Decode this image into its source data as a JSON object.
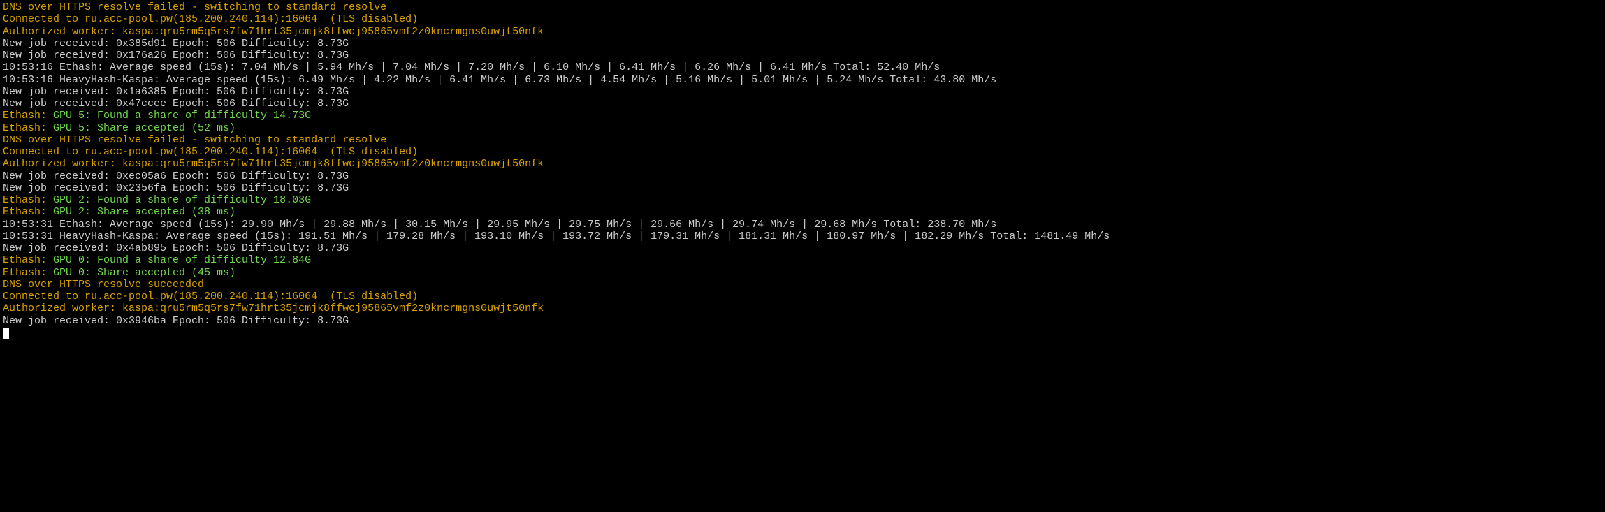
{
  "colors": {
    "orange": "#d8a100",
    "white": "#cccccc",
    "green": "#6fd84d",
    "background": "#000000"
  },
  "lines": [
    {
      "segments": [
        {
          "color": "orange",
          "text": "DNS over HTTPS resolve failed - switching to standard resolve"
        }
      ]
    },
    {
      "segments": [
        {
          "color": "orange",
          "text": "Connected to ru.acc-pool.pw(185.200.240.114):16064  (TLS disabled)"
        }
      ]
    },
    {
      "segments": [
        {
          "color": "orange",
          "text": "Authorized worker: kaspa:qru5rm5q5rs7fw71hrt35jcmjk8ffwcj95865vmf2z0kncrmgns0uwjt50nfk"
        }
      ]
    },
    {
      "segments": [
        {
          "color": "white",
          "text": "New job received: 0x385d91 Epoch: 506 Difficulty: 8.73G"
        }
      ]
    },
    {
      "segments": [
        {
          "color": "white",
          "text": "New job received: 0x176a26 Epoch: 506 Difficulty: 8.73G"
        }
      ]
    },
    {
      "segments": [
        {
          "color": "white",
          "text": "10:53:16 Ethash: Average speed (15s): 7.04 Mh/s | 5.94 Mh/s | 7.04 Mh/s | 7.20 Mh/s | 6.10 Mh/s | 6.41 Mh/s | 6.26 Mh/s | 6.41 Mh/s Total: 52.40 Mh/s"
        }
      ]
    },
    {
      "segments": [
        {
          "color": "white",
          "text": "10:53:16 HeavyHash-Kaspa: Average speed (15s): 6.49 Mh/s | 4.22 Mh/s | 6.41 Mh/s | 6.73 Mh/s | 4.54 Mh/s | 5.16 Mh/s | 5.01 Mh/s | 5.24 Mh/s Total: 43.80 Mh/s"
        }
      ]
    },
    {
      "segments": [
        {
          "color": "white",
          "text": "New job received: 0x1a6385 Epoch: 506 Difficulty: 8.73G"
        }
      ]
    },
    {
      "segments": [
        {
          "color": "white",
          "text": "New job received: 0x47ccee Epoch: 506 Difficulty: 8.73G"
        }
      ]
    },
    {
      "segments": [
        {
          "color": "orange",
          "text": "Ethash: "
        },
        {
          "color": "green",
          "text": "GPU 5: Found a share of difficulty 14.73G"
        }
      ]
    },
    {
      "segments": [
        {
          "color": "orange",
          "text": "Ethash: "
        },
        {
          "color": "green",
          "text": "GPU 5: Share accepted (52 ms)"
        }
      ]
    },
    {
      "segments": [
        {
          "color": "orange",
          "text": "DNS over HTTPS resolve failed - switching to standard resolve"
        }
      ]
    },
    {
      "segments": [
        {
          "color": "orange",
          "text": "Connected to ru.acc-pool.pw(185.200.240.114):16064  (TLS disabled)"
        }
      ]
    },
    {
      "segments": [
        {
          "color": "orange",
          "text": "Authorized worker: kaspa:qru5rm5q5rs7fw71hrt35jcmjk8ffwcj95865vmf2z0kncrmgns0uwjt50nfk"
        }
      ]
    },
    {
      "segments": [
        {
          "color": "white",
          "text": "New job received: 0xec05a6 Epoch: 506 Difficulty: 8.73G"
        }
      ]
    },
    {
      "segments": [
        {
          "color": "white",
          "text": "New job received: 0x2356fa Epoch: 506 Difficulty: 8.73G"
        }
      ]
    },
    {
      "segments": [
        {
          "color": "orange",
          "text": "Ethash: "
        },
        {
          "color": "green",
          "text": "GPU 2: Found a share of difficulty 18.03G"
        }
      ]
    },
    {
      "segments": [
        {
          "color": "orange",
          "text": "Ethash: "
        },
        {
          "color": "green",
          "text": "GPU 2: Share accepted (38 ms)"
        }
      ]
    },
    {
      "segments": [
        {
          "color": "white",
          "text": "10:53:31 Ethash: Average speed (15s): 29.90 Mh/s | 29.88 Mh/s | 30.15 Mh/s | 29.95 Mh/s | 29.75 Mh/s | 29.66 Mh/s | 29.74 Mh/s | 29.68 Mh/s Total: 238.70 Mh/s"
        }
      ]
    },
    {
      "segments": [
        {
          "color": "white",
          "text": "10:53:31 HeavyHash-Kaspa: Average speed (15s): 191.51 Mh/s | 179.28 Mh/s | 193.10 Mh/s | 193.72 Mh/s | 179.31 Mh/s | 181.31 Mh/s | 180.97 Mh/s | 182.29 Mh/s Total: 1481.49 Mh/s"
        }
      ]
    },
    {
      "segments": [
        {
          "color": "white",
          "text": "New job received: 0x4ab895 Epoch: 506 Difficulty: 8.73G"
        }
      ]
    },
    {
      "segments": [
        {
          "color": "orange",
          "text": "Ethash: "
        },
        {
          "color": "green",
          "text": "GPU 0: Found a share of difficulty 12.84G"
        }
      ]
    },
    {
      "segments": [
        {
          "color": "orange",
          "text": "Ethash: "
        },
        {
          "color": "green",
          "text": "GPU 0: Share accepted (45 ms)"
        }
      ]
    },
    {
      "segments": [
        {
          "color": "orange",
          "text": "DNS over HTTPS resolve succeeded"
        }
      ]
    },
    {
      "segments": [
        {
          "color": "orange",
          "text": "Connected to ru.acc-pool.pw(185.200.240.114):16064  (TLS disabled)"
        }
      ]
    },
    {
      "segments": [
        {
          "color": "orange",
          "text": "Authorized worker: kaspa:qru5rm5q5rs7fw71hrt35jcmjk8ffwcj95865vmf2z0kncrmgns0uwjt50nfk"
        }
      ]
    },
    {
      "segments": [
        {
          "color": "white",
          "text": "New job received: 0x3946ba Epoch: 506 Difficulty: 8.73G"
        }
      ]
    }
  ]
}
